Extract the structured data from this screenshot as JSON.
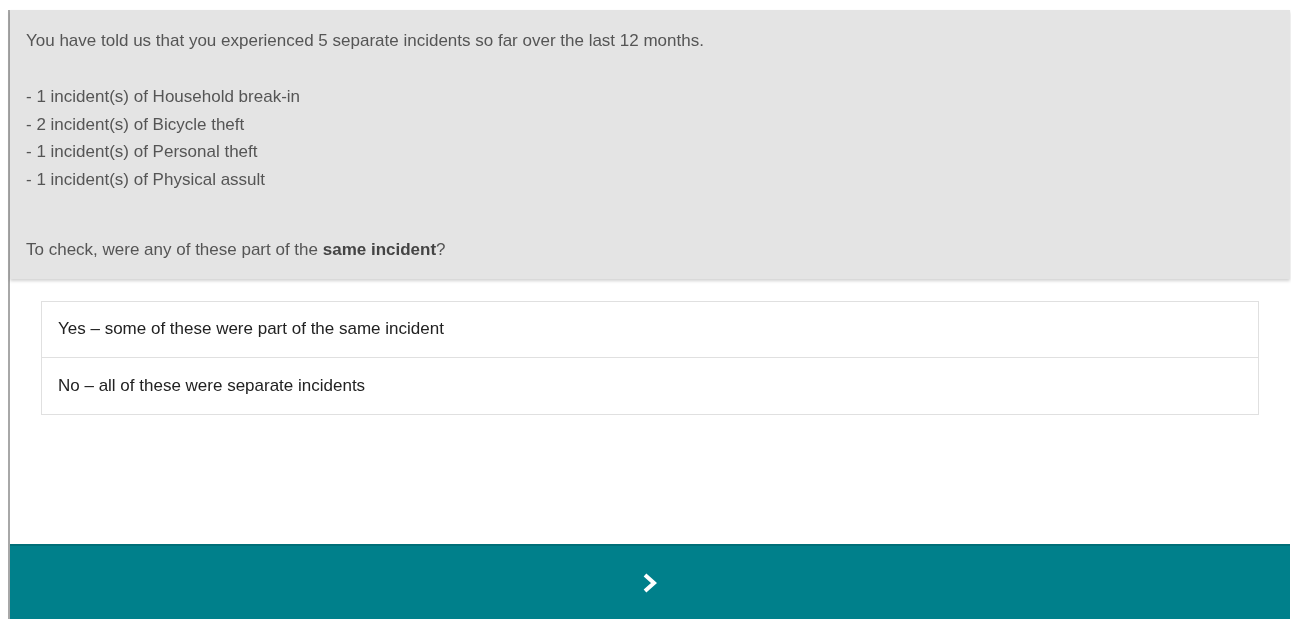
{
  "question": {
    "intro": "You have told us that you experienced 5 separate incidents so far over the last 12 months.",
    "incidents": [
      "- 1 incident(s) of Household break-in",
      "- 2 incident(s) of Bicycle theft",
      "- 1 incident(s) of Personal theft",
      "- 1 incident(s) of Physical assult"
    ],
    "prompt": "To check, were any of these part of the **same incident**?"
  },
  "options": [
    {
      "label": "Yes – some of these were part of the same incident",
      "selected": false
    },
    {
      "label": "No – all of these were separate incidents",
      "selected": false
    }
  ],
  "next_button": {
    "kind": "chevron"
  }
}
